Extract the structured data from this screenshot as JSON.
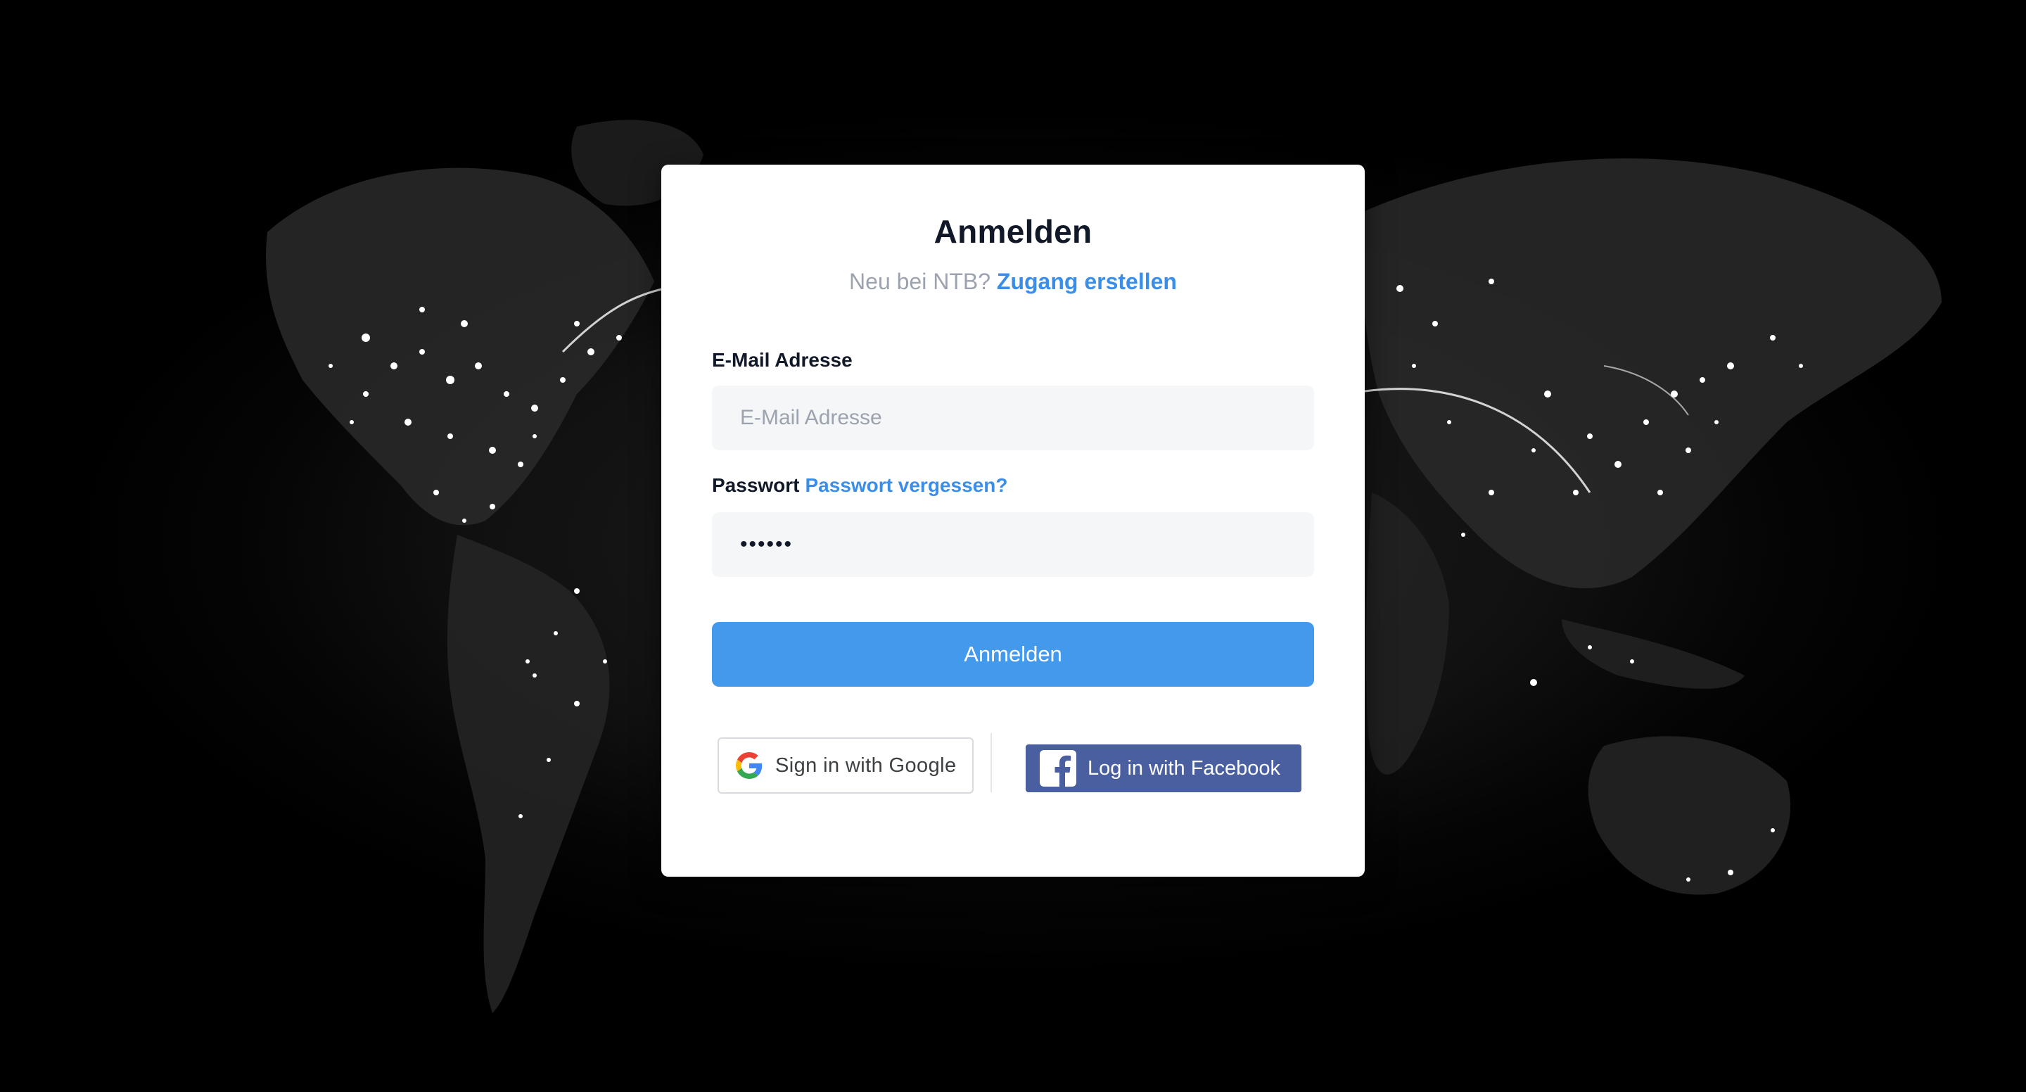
{
  "page": {
    "title": "Anmelden",
    "subtitle_prefix": "Neu bei NTB?",
    "create_account_link": "Zugang erstellen"
  },
  "form": {
    "email_label": "E-Mail Adresse",
    "email_placeholder": "E-Mail Adresse",
    "email_value": "",
    "password_label": "Passwort",
    "forgot_password_link": "Passwort vergessen?",
    "password_value": "••••••",
    "submit_label": "Anmelden"
  },
  "social": {
    "google_label": "Sign in with Google",
    "google_icon": "google-g-icon",
    "facebook_label": "Log in with Facebook",
    "facebook_icon": "facebook-f-icon"
  },
  "colors": {
    "accent": "#4399ec",
    "link": "#3b8ee8",
    "facebook": "#4a5f9f",
    "background": "#000000",
    "card": "#ffffff"
  }
}
